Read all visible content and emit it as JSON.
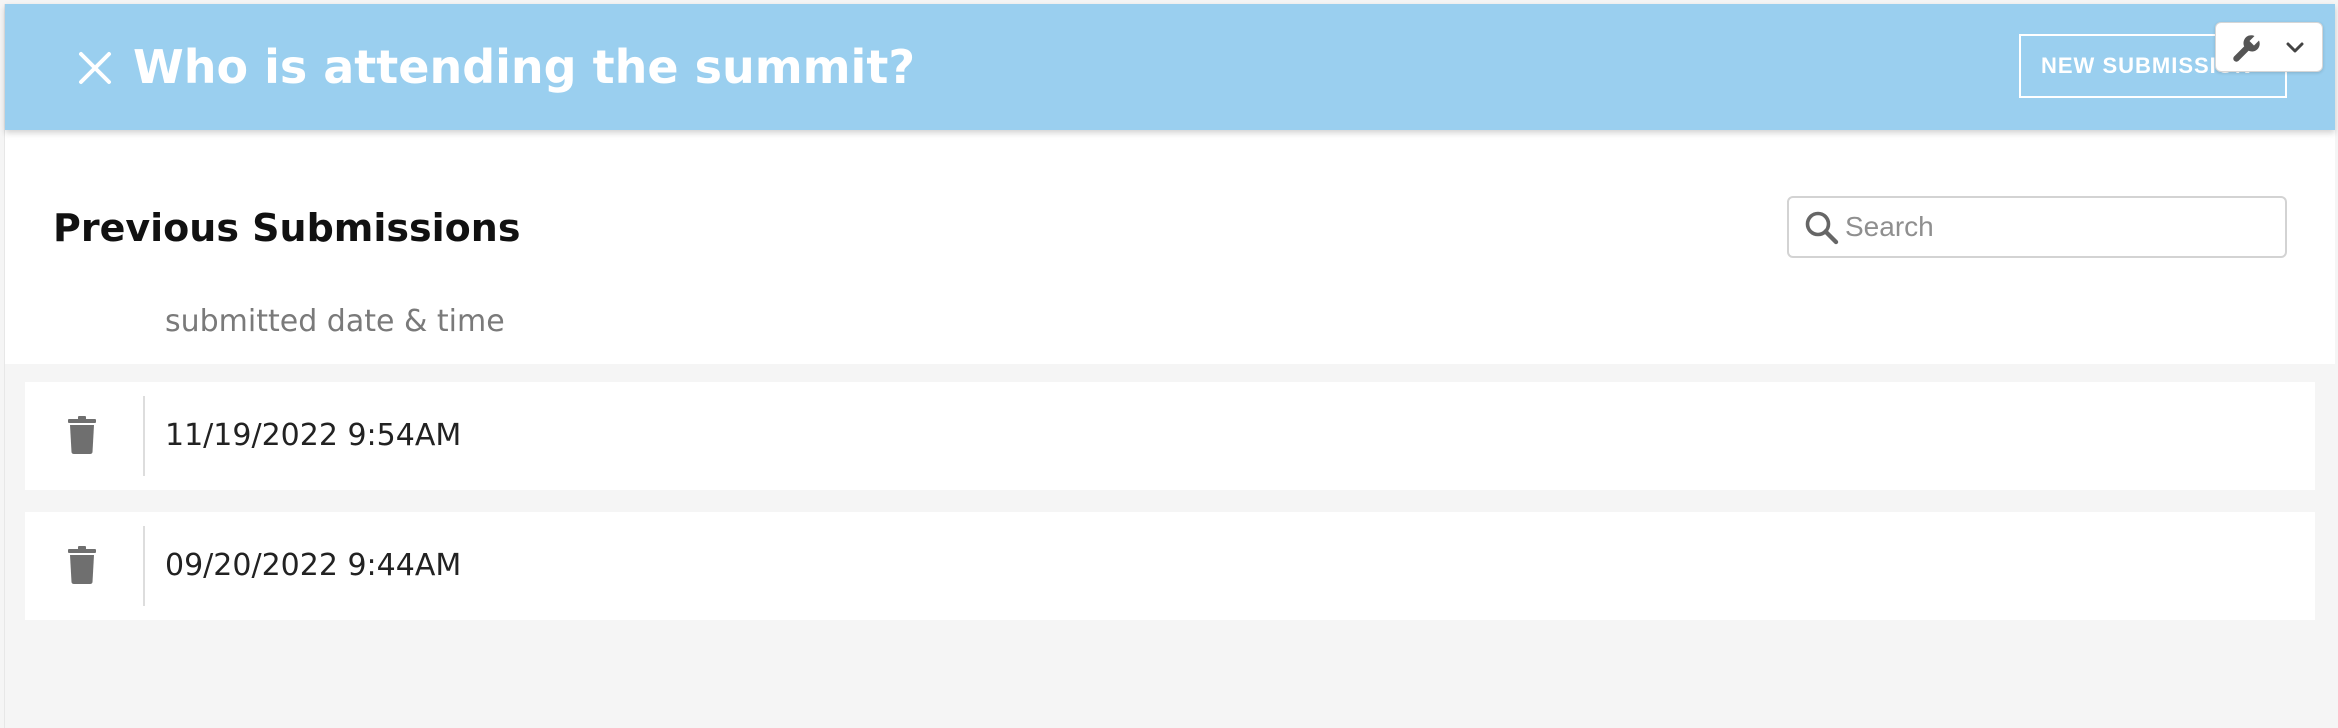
{
  "header": {
    "title": "Who is attending the summit?",
    "new_submission_label": "NEW SUBMISSION",
    "background_color": "#9acfef",
    "close_icon": "close-icon",
    "tools_icons": [
      "wrench-icon",
      "chevron-down-icon"
    ]
  },
  "main": {
    "section_title": "Previous Submissions",
    "search": {
      "placeholder": "Search",
      "value": ""
    },
    "column_header": "submitted date & time",
    "submissions": [
      {
        "datetime": "11/19/2022 9:54AM",
        "delete_icon": "trash-icon"
      },
      {
        "datetime": "09/20/2022 9:44AM",
        "delete_icon": "trash-icon"
      }
    ]
  }
}
